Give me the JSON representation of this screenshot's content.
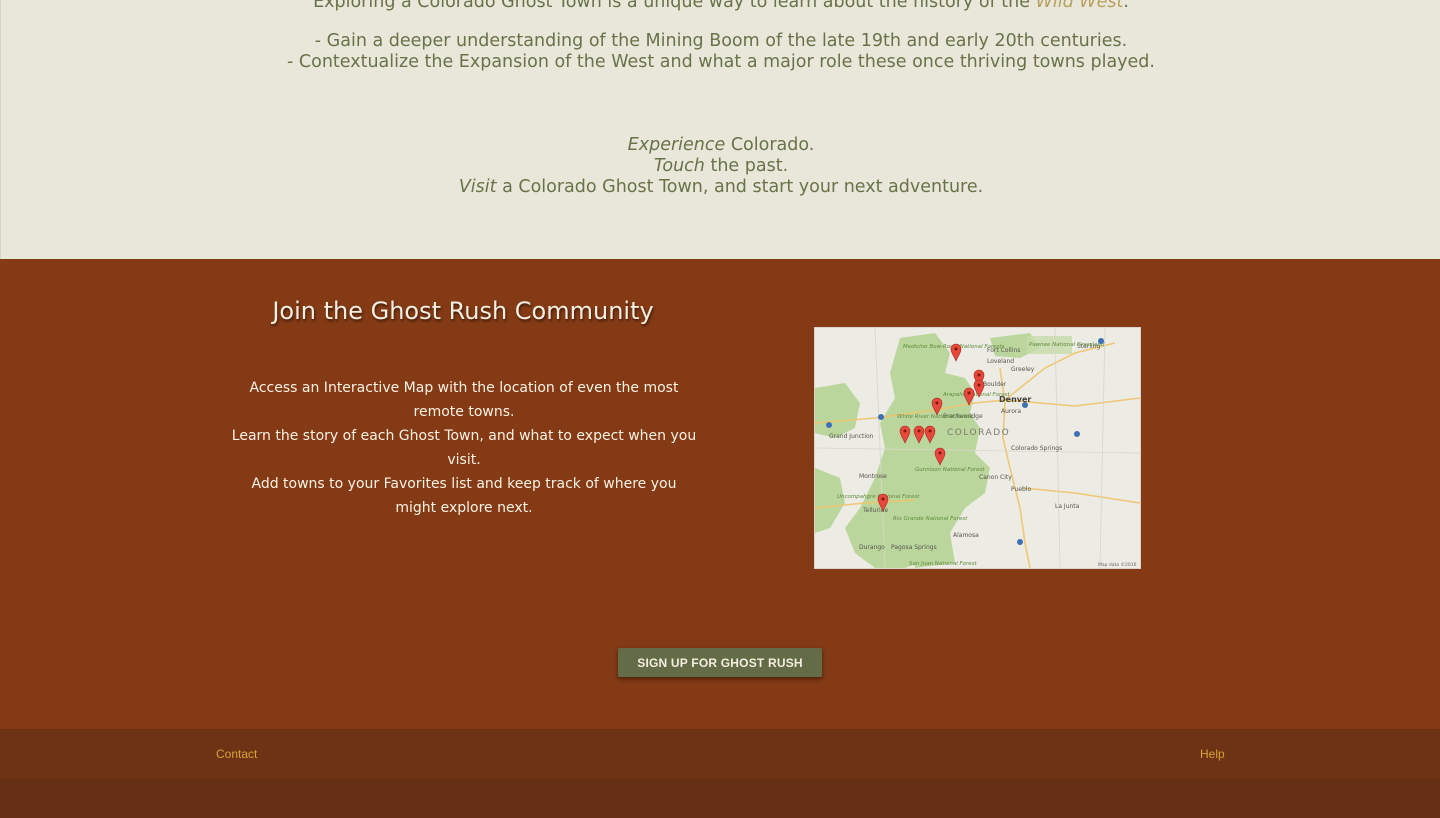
{
  "intro": {
    "line0_text": "Exploring a Colorado Ghost Town is a unique way to learn about the history of the",
    "line0_highlight": "Wild West",
    "line0_end": ".",
    "line1": "- Gain a deeper understanding of the Mining Boom of the late 19th and early 20th centuries.",
    "line2": "- Contextualize the Expansion of the West and what a major role these once thriving towns played.",
    "tag1_em": "Experience",
    "tag1_rest": " Colorado.",
    "tag2_em": "Touch",
    "tag2_rest": " the past.",
    "tag3_em": "Visit",
    "tag3_rest": " a Colorado Ghost Town, and start your next adventure."
  },
  "community": {
    "heading": "Join the Ghost Rush Community",
    "feature1": "Access an Interactive Map with the location of even the most remote towns.",
    "feature2": "Learn the story of each Ghost Town, and what to expect when you visit.",
    "feature3": "Add towns to your Favorites list and keep track of where you might explore next.",
    "signup_label": "SIGN UP FOR GHOST RUSH"
  },
  "map": {
    "state_label": "COLORADO",
    "cities": [
      "Fort Collins",
      "Loveland",
      "Greeley",
      "Boulder",
      "Denver",
      "Aurora",
      "Sterling",
      "Colorado Springs",
      "Pueblo",
      "Canon City",
      "Grand Junction",
      "Montrose",
      "Telluride",
      "Durango",
      "Pagosa Springs",
      "Alamosa",
      "Breckenridge",
      "La Junta"
    ],
    "forests": [
      "Medicine Bow-Routt National Forests",
      "Arapaho National Forest",
      "White River National Forest",
      "Gunnison National Forest",
      "Uncompahgre National Forest",
      "Rio Grande National Forest",
      "San Juan National Forest",
      "Pawnee National Grassland"
    ],
    "attribution": "Map data ©2016",
    "pin_color": "#e8473c",
    "pin_count": 10
  },
  "footer": {
    "contact_label": "Contact",
    "help_label": "Help",
    "link_color": "#d9a23a"
  },
  "colors": {
    "intro_bg": "#e8e7da",
    "intro_text": "#687349",
    "community_bg": "#833a15",
    "button_bg": "#636b47",
    "footer_bg": "#6e3214"
  }
}
